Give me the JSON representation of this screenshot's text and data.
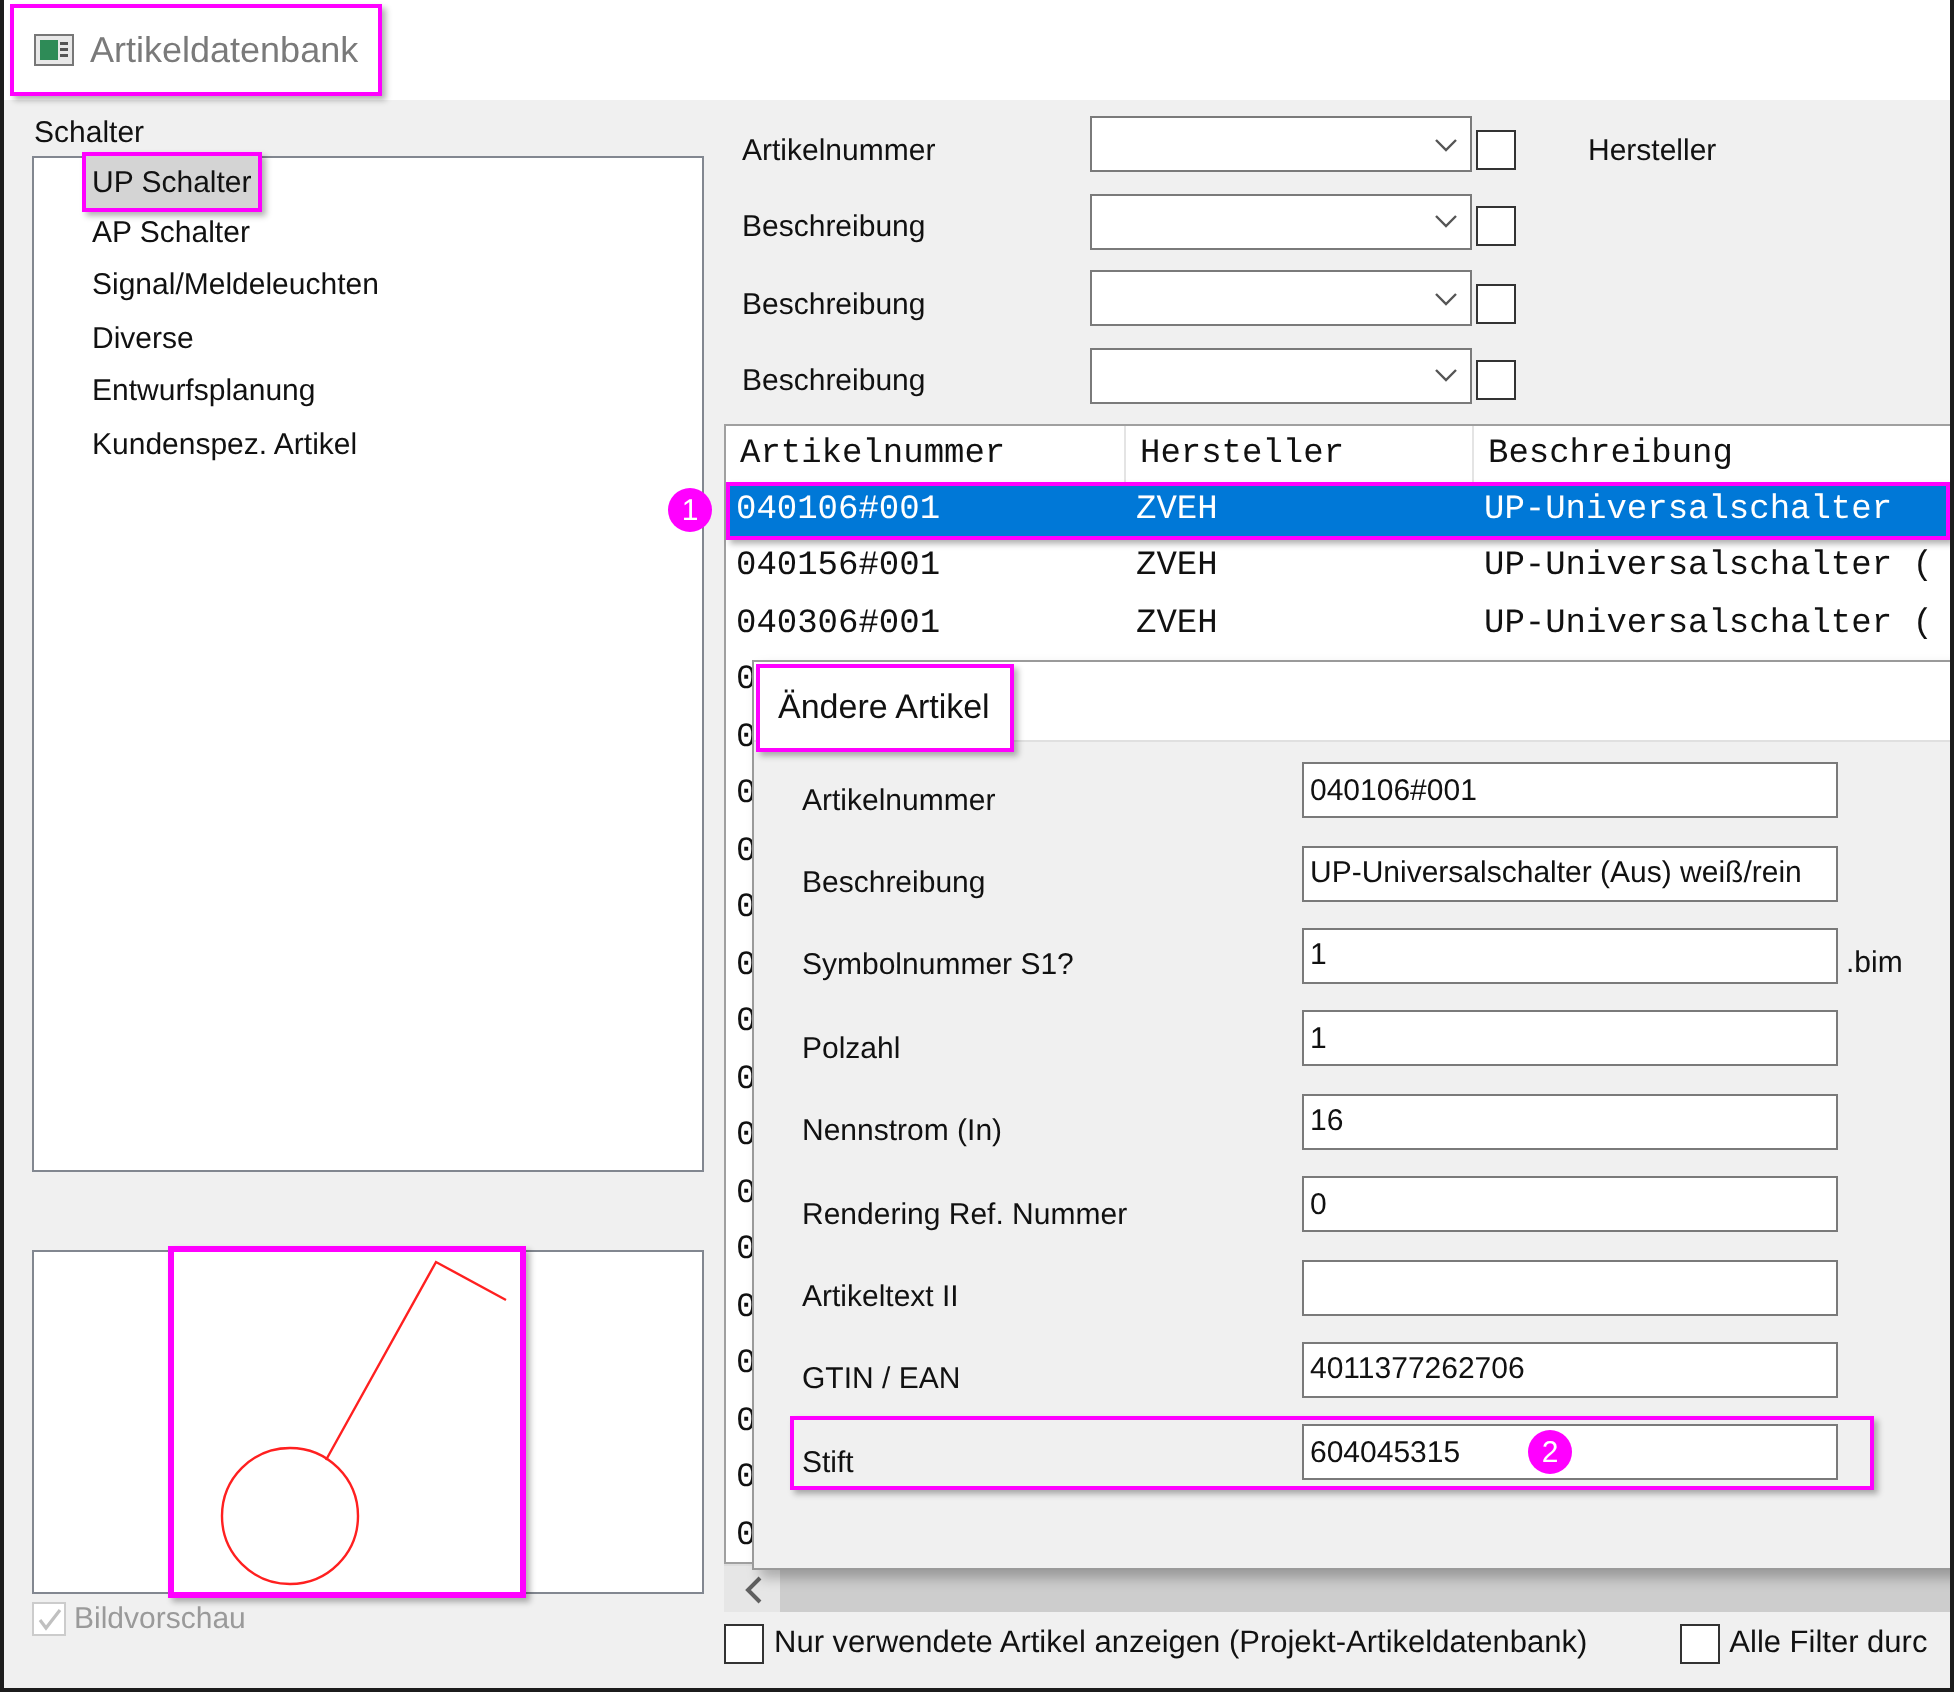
{
  "window": {
    "title": "Artikeldatenbank",
    "highlighted": true
  },
  "category_panel": {
    "label": "Schalter",
    "items": [
      {
        "label": "UP Schalter",
        "selected": true,
        "highlighted": true
      },
      {
        "label": "AP Schalter",
        "selected": false,
        "highlighted": false
      },
      {
        "label": "Signal/Meldeleuchten",
        "selected": false,
        "highlighted": false
      },
      {
        "label": "Diverse",
        "selected": false,
        "highlighted": false
      },
      {
        "label": "Entwurfsplanung",
        "selected": false,
        "highlighted": false
      },
      {
        "label": "Kundenspez. Artikel",
        "selected": false,
        "highlighted": false
      }
    ]
  },
  "preview": {
    "highlighted": true,
    "checkbox": {
      "label": "Bildvorschau",
      "checked": true,
      "disabled": true
    }
  },
  "filters": [
    {
      "label": "Artikelnummer",
      "checked": false,
      "side_label": "Hersteller"
    },
    {
      "label": "Beschreibung",
      "checked": false
    },
    {
      "label": "Beschreibung",
      "checked": false
    },
    {
      "label": "Beschreibung",
      "checked": false
    }
  ],
  "table": {
    "columns": [
      "Artikelnummer",
      "Hersteller",
      "Beschreibung"
    ],
    "rows": [
      {
        "cells": [
          "040106#001",
          "ZVEH",
          "UP-Universalschalter"
        ],
        "selected": true,
        "highlighted": true,
        "badge": "1"
      },
      {
        "cells": [
          "040156#001",
          "ZVEH",
          "UP-Universalschalter ("
        ],
        "selected": false,
        "highlighted": false
      },
      {
        "cells": [
          "040306#001",
          "ZVEH",
          "UP-Universalschalter ("
        ],
        "selected": false,
        "highlighted": false
      },
      {
        "cells": [
          "0"
        ],
        "selected": false,
        "highlighted": false
      },
      {
        "cells": [
          "0"
        ],
        "selected": false,
        "highlighted": false
      },
      {
        "cells": [
          "0"
        ],
        "selected": false,
        "highlighted": false
      },
      {
        "cells": [
          "0"
        ],
        "selected": false,
        "highlighted": false
      },
      {
        "cells": [
          "0"
        ],
        "selected": false,
        "highlighted": false
      },
      {
        "cells": [
          "0"
        ],
        "selected": false,
        "highlighted": false
      },
      {
        "cells": [
          "0"
        ],
        "selected": false,
        "highlighted": false
      },
      {
        "cells": [
          "0"
        ],
        "selected": false,
        "highlighted": false
      },
      {
        "cells": [
          "0"
        ],
        "selected": false,
        "highlighted": false
      },
      {
        "cells": [
          "0"
        ],
        "selected": false,
        "highlighted": false
      },
      {
        "cells": [
          "0"
        ],
        "selected": false,
        "highlighted": false
      },
      {
        "cells": [
          "0"
        ],
        "selected": false,
        "highlighted": false
      },
      {
        "cells": [
          "0"
        ],
        "selected": false,
        "highlighted": false
      },
      {
        "cells": [
          "0"
        ],
        "selected": false,
        "highlighted": false
      },
      {
        "cells": [
          "0"
        ],
        "selected": false,
        "highlighted": false
      },
      {
        "cells": [
          "0"
        ],
        "selected": false,
        "highlighted": false
      }
    ]
  },
  "dialog": {
    "title": "Ändere Artikel",
    "title_highlighted": true,
    "fields": [
      {
        "label": "Artikelnummer",
        "value": "040106#001",
        "highlighted": false
      },
      {
        "label": "Beschreibung",
        "value": "UP-Universalschalter (Aus) weiß/rein",
        "highlighted": false
      },
      {
        "label": "Symbolnummer S1?",
        "value": "1",
        "suffix": ".bim",
        "highlighted": false
      },
      {
        "label": "Polzahl",
        "value": "1",
        "highlighted": false
      },
      {
        "label": "Nennstrom (In)",
        "value": "16",
        "highlighted": false
      },
      {
        "label": "Rendering Ref. Nummer",
        "value": "0",
        "highlighted": false
      },
      {
        "label": "Artikeltext II",
        "highlighted": false
      },
      {
        "label": "GTIN / EAN",
        "value": "4011377262706",
        "highlighted": false
      },
      {
        "label": "Stift",
        "value": "604045315",
        "highlighted": true,
        "badge": "2"
      }
    ]
  },
  "options": [
    {
      "label": "Nur verwendete Artikel anzeigen (Projekt-Artikeldatenbank)",
      "checked": false
    },
    {
      "label": "Alle Filter durc",
      "checked": false
    }
  ]
}
